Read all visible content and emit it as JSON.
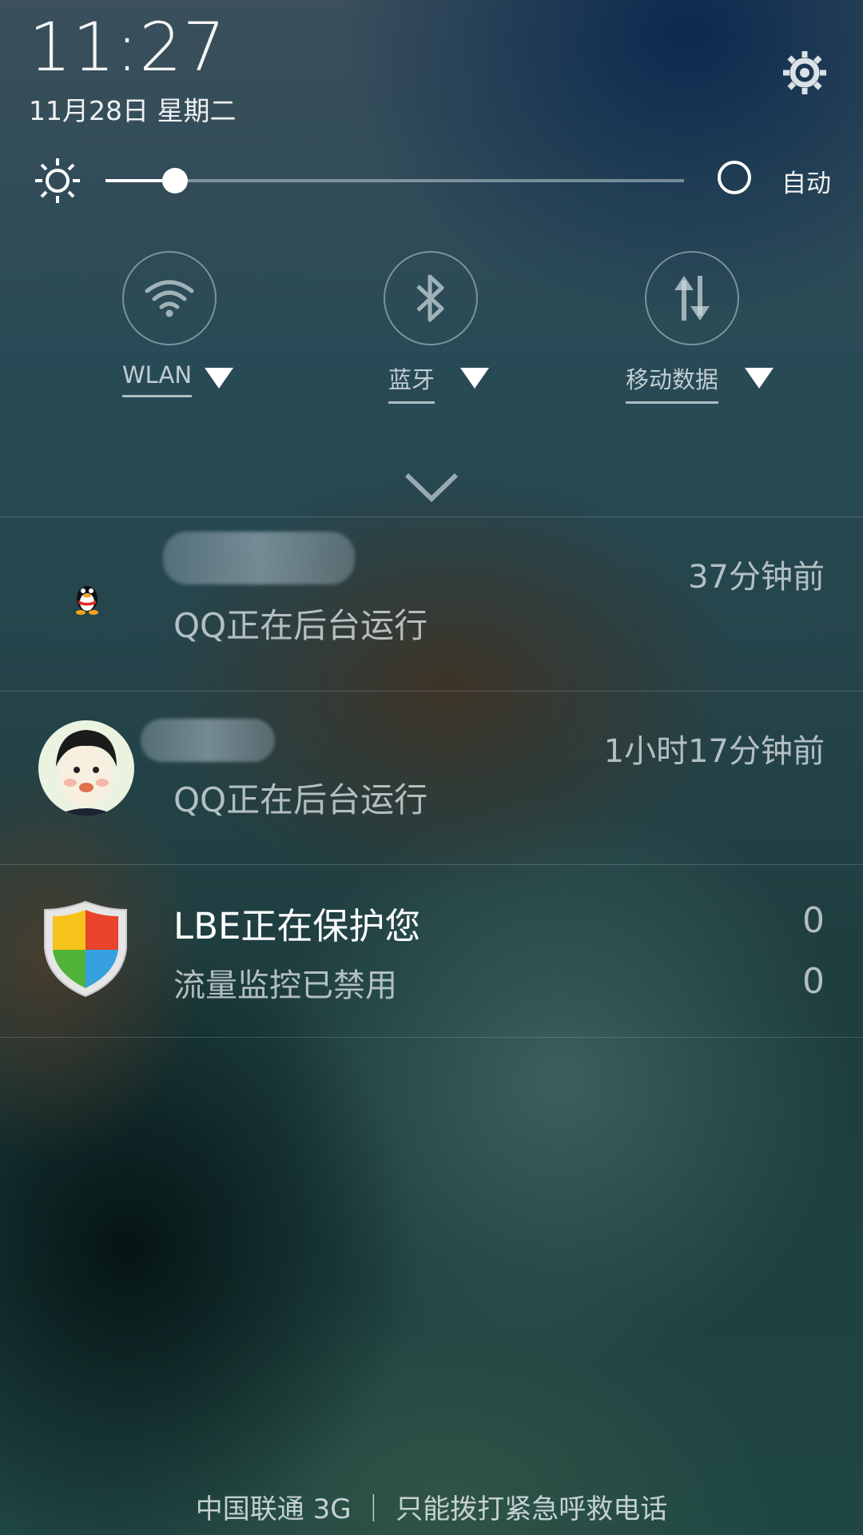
{
  "status": {
    "time": "11:27",
    "date": "11月28日 星期二"
  },
  "header": {
    "settings_icon": "gear-icon"
  },
  "brightness": {
    "level": 0.12,
    "icon": "sun-icon",
    "auto_label": "自动",
    "auto_enabled": false
  },
  "toggles": [
    {
      "label": "WLAN",
      "icon": "wifi-icon"
    },
    {
      "label": "蓝牙",
      "icon": "bluetooth-icon"
    },
    {
      "label": "移动数据",
      "icon": "mobile-data-icon"
    }
  ],
  "notifications": [
    {
      "title": "",
      "subtitle": "QQ正在后台运行",
      "time": "37分钟前",
      "icon": "qq-penguin-icon"
    },
    {
      "title": "",
      "subtitle": "QQ正在后台运行",
      "time": "1小时17分钟前",
      "icon": "avatar"
    },
    {
      "title": "LBE正在保护您",
      "subtitle": "流量监控已禁用",
      "value_top": "0",
      "value_bottom": "0",
      "icon": "shield-icon"
    }
  ],
  "footer": {
    "carrier_text": "中国联通 3G ｜ 只能拨打紧急呼救电话"
  },
  "colors": {
    "accent": "#ffffff",
    "muted_text": "#d7dee2"
  }
}
